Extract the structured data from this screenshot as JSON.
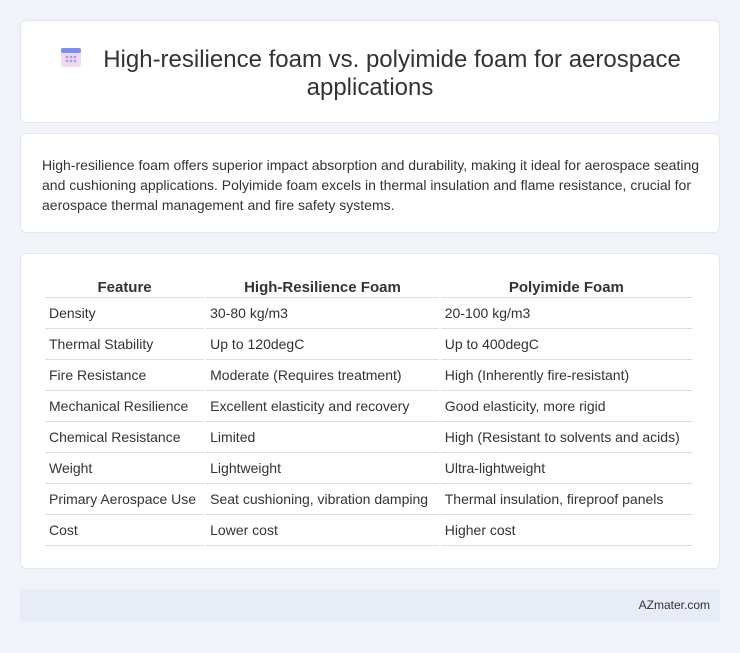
{
  "header": {
    "icon": "calendar-icon",
    "title": "High-resilience foam vs. polyimide foam for aerospace applications"
  },
  "summary": {
    "text": "High-resilience foam offers superior impact absorption and durability, making it ideal for aerospace seating and cushioning applications. Polyimide foam excels in thermal insulation and flame resistance, crucial for aerospace thermal management and fire safety systems."
  },
  "table": {
    "headers": [
      "Feature",
      "High-Resilience Foam",
      "Polyimide Foam"
    ],
    "rows": [
      [
        "Density",
        "30-80 kg/m3",
        "20-100 kg/m3"
      ],
      [
        "Thermal Stability",
        "Up to 120degC",
        "Up to 400degC"
      ],
      [
        "Fire Resistance",
        "Moderate (Requires treatment)",
        "High (Inherently fire-resistant)"
      ],
      [
        "Mechanical Resilience",
        "Excellent elasticity and recovery",
        "Good elasticity, more rigid"
      ],
      [
        "Chemical Resistance",
        "Limited",
        "High (Resistant to solvents and acids)"
      ],
      [
        "Weight",
        "Lightweight",
        "Ultra-lightweight"
      ],
      [
        "Primary Aerospace Use",
        "Seat cushioning, vibration damping",
        "Thermal insulation, fireproof panels"
      ],
      [
        "Cost",
        "Lower cost",
        "Higher cost"
      ]
    ]
  },
  "footer": {
    "text": "AZmater.com"
  },
  "colors": {
    "page_background": "#f0f3f8",
    "footer_background": "#e7ecf6",
    "icon_top": "#7b8ff0",
    "icon_body": "#f3d8ee"
  }
}
